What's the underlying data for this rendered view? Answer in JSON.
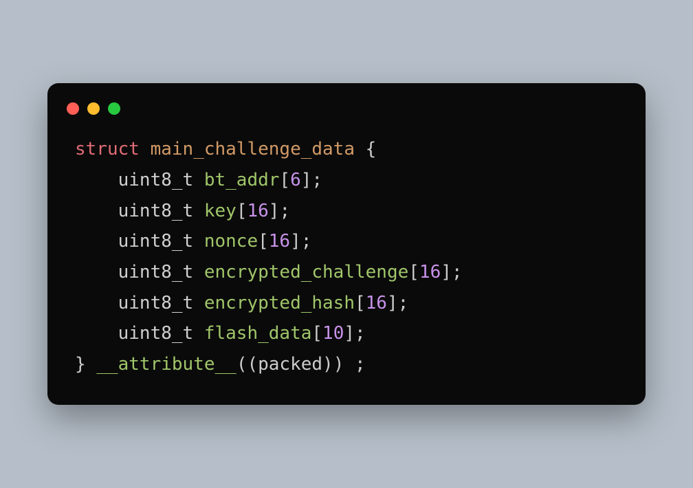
{
  "code": {
    "keyword_struct": "struct",
    "struct_name": "main_challenge_data",
    "open_brace": "{",
    "close_brace": "}",
    "fields": [
      {
        "type": "uint8_t",
        "name": "bt_addr",
        "size": "6"
      },
      {
        "type": "uint8_t",
        "name": "key",
        "size": "16"
      },
      {
        "type": "uint8_t",
        "name": "nonce",
        "size": "16"
      },
      {
        "type": "uint8_t",
        "name": "encrypted_challenge",
        "size": "16"
      },
      {
        "type": "uint8_t",
        "name": "encrypted_hash",
        "size": "16"
      },
      {
        "type": "uint8_t",
        "name": "flash_data",
        "size": "10"
      }
    ],
    "attribute_name": "__attribute__",
    "attribute_arg": "packed",
    "open_paren": "(",
    "close_paren": ")",
    "open_bracket": "[",
    "close_bracket": "]",
    "semicolon": ";"
  }
}
